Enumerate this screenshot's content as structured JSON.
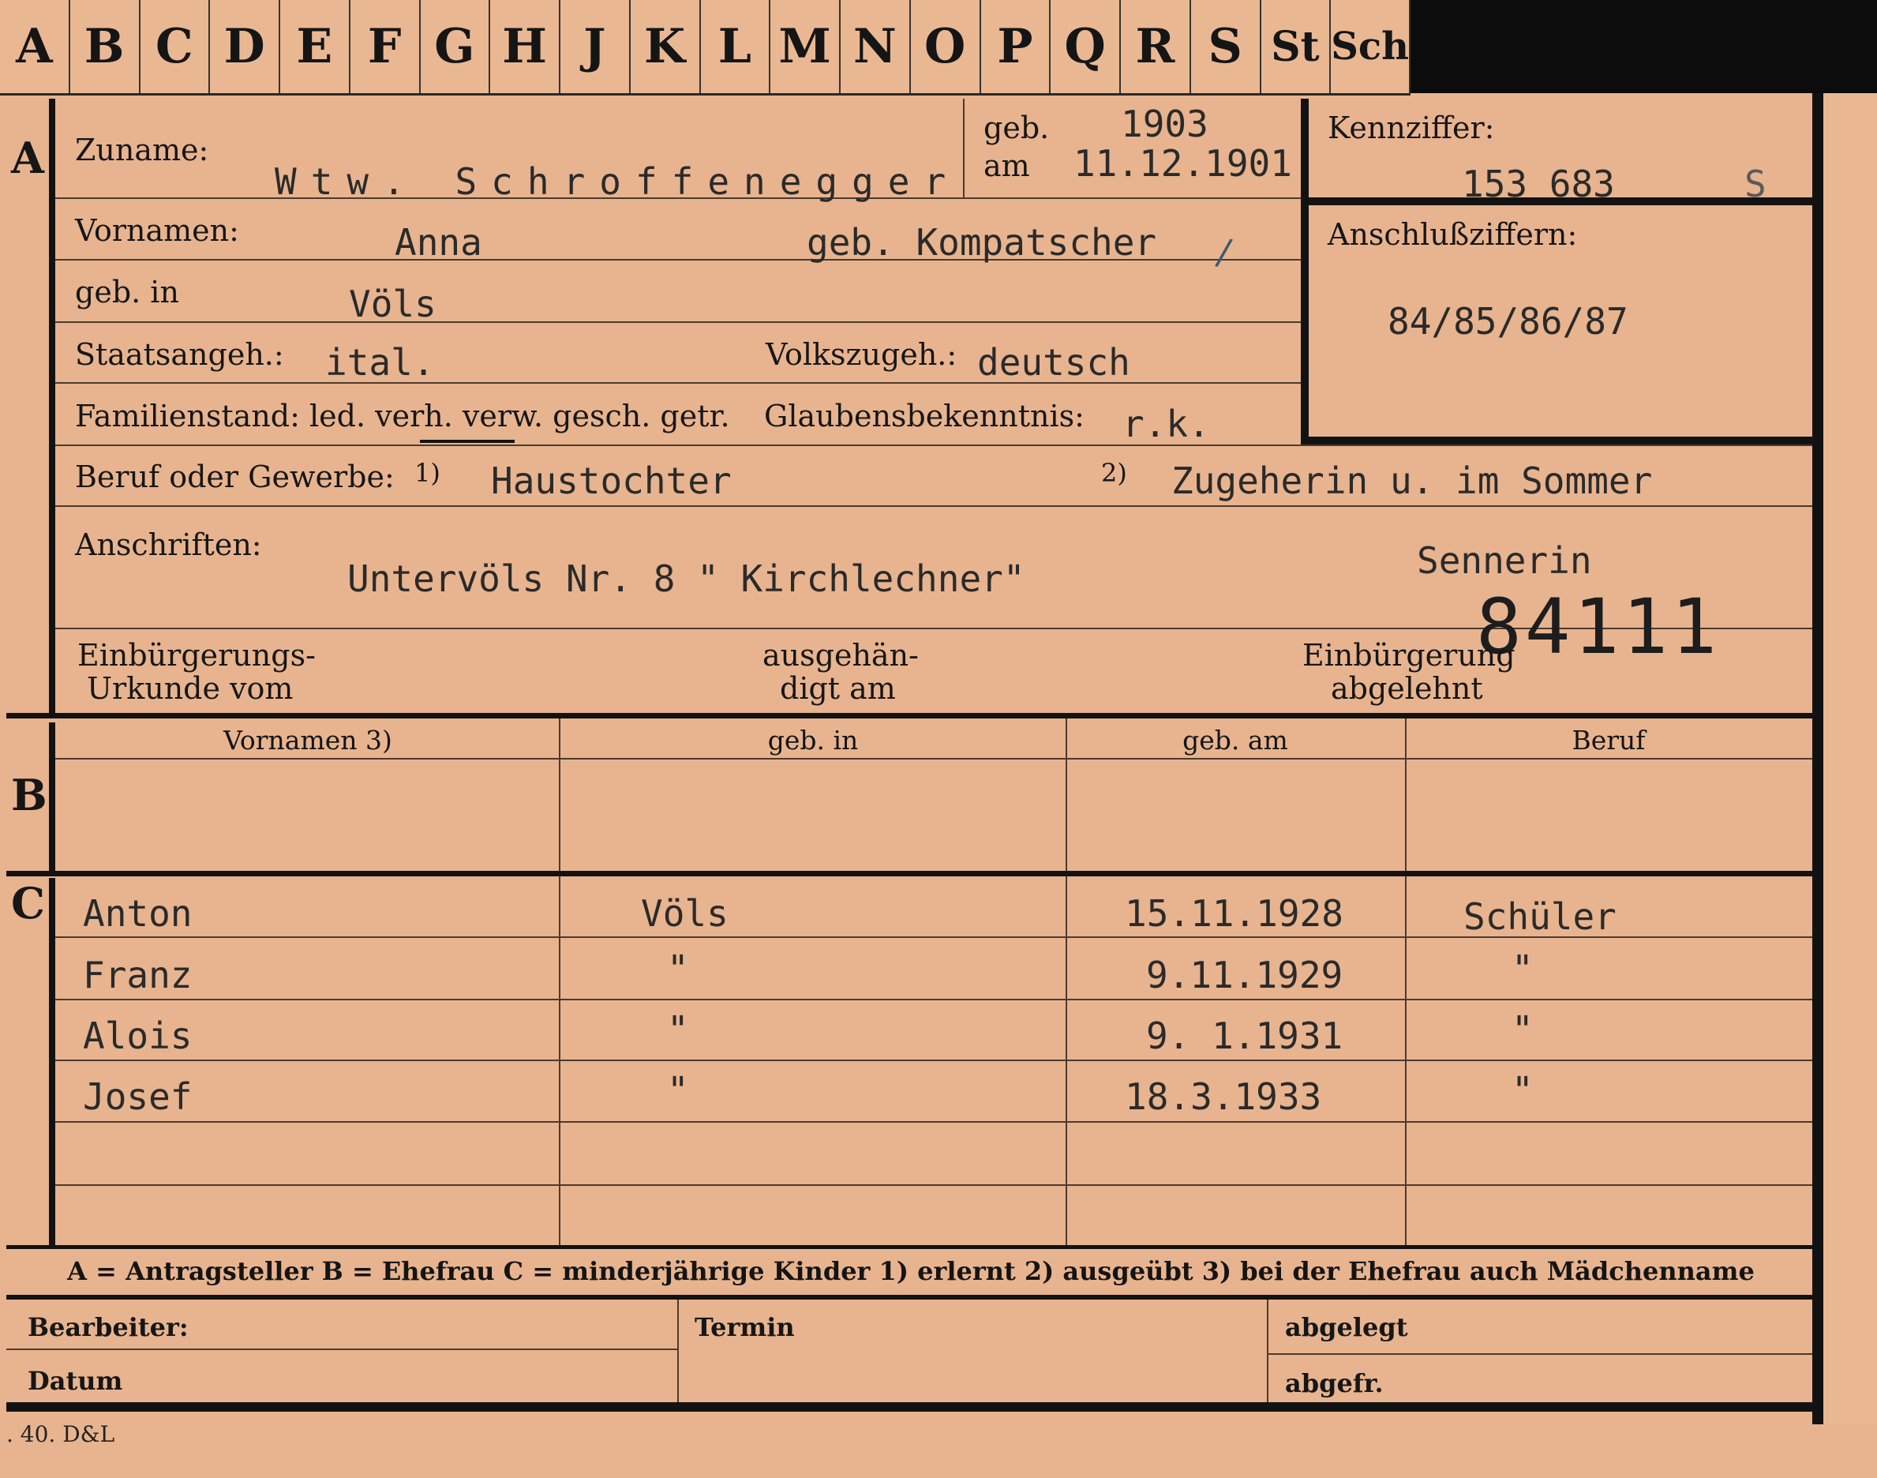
{
  "tabs": [
    "A",
    "B",
    "C",
    "D",
    "E",
    "F",
    "G",
    "H",
    "J",
    "K",
    "L",
    "M",
    "N",
    "O",
    "P",
    "Q",
    "R",
    "S",
    "St",
    "Sch"
  ],
  "sections": {
    "a": "A",
    "b": "B",
    "c": "C"
  },
  "labels": {
    "zuname": "Zuname:",
    "geb": "geb.",
    "am": "am",
    "kennziffer": "Kennziffer:",
    "vornamen": "Vornamen:",
    "anschlussziffern": "Anschlußziffern:",
    "geb_in": "geb. in",
    "staatsangeh": "Staatsangeh.:",
    "volkszugeh": "Volkszugeh.:",
    "familienstand": "Familienstand: led. verh. verw. gesch. getr.",
    "glaubensbekenntnis": "Glaubensbekenntnis:",
    "beruf": "Beruf oder Gewerbe:",
    "fn1": "1)",
    "fn2": "2)",
    "anschriften": "Anschriften:",
    "einbuergerung_urkunde_1": "Einbürgerungs-",
    "einbuergerung_urkunde_2": "Urkunde vom",
    "ausgehaendigt_1": "ausgehän-",
    "ausgehaendigt_2": "digt am",
    "einbuergerung_abgelehnt_1": "Einbürgerung",
    "einbuergerung_abgelehnt_2": "abgelehnt"
  },
  "values": {
    "zuname": "Wtw. Schroffenegger",
    "geb_year": "1903",
    "geb_date": "11.12.1901",
    "kennziffer": "153 683",
    "kennziffer_suffix": "S",
    "vornamen": "Anna",
    "geb_name": "geb. Kompatscher",
    "anschlussziffern": "84/85/86/87",
    "geb_in": "Völs",
    "staatsangeh": "ital.",
    "volkszugeh": "deutsch",
    "glaubensbekenntnis": "r.k.",
    "beruf_erlernt": "Haustochter",
    "beruf_ausgeuebt": "Zugeherin u. im Sommer",
    "beruf_ausgeuebt_2": "Sennerin",
    "anschrift": "Untervöls Nr. 8 \" Kirchlechner\"",
    "stamp_number": "84111"
  },
  "table_headers": {
    "vornamen": "Vornamen 3)",
    "geb_in": "geb. in",
    "geb_am": "geb. am",
    "beruf": "Beruf"
  },
  "children": [
    {
      "name": "Anton",
      "geb_in": "Völs",
      "geb_am": "15.11.1928",
      "beruf": "Schüler"
    },
    {
      "name": "Franz",
      "geb_in": "\"",
      "geb_am": "9.11.1929",
      "beruf": "\""
    },
    {
      "name": "Alois",
      "geb_in": "\"",
      "geb_am": "9. 1.1931",
      "beruf": "\""
    },
    {
      "name": "Josef",
      "geb_in": "\"",
      "geb_am": "18.3.1933",
      "beruf": "\""
    }
  ],
  "legend": "A = Antragsteller   B = Ehefrau   C = minderjährige Kinder   1) erlernt   2) ausgeübt   3) bei der Ehefrau auch Mädchenname",
  "bottom": {
    "bearbeiter": "Bearbeiter:",
    "datum": "Datum",
    "termin": "Termin",
    "abgelegt": "abgelegt",
    "abgefr": "abgefr."
  },
  "footer_print": ". 40. D&L"
}
